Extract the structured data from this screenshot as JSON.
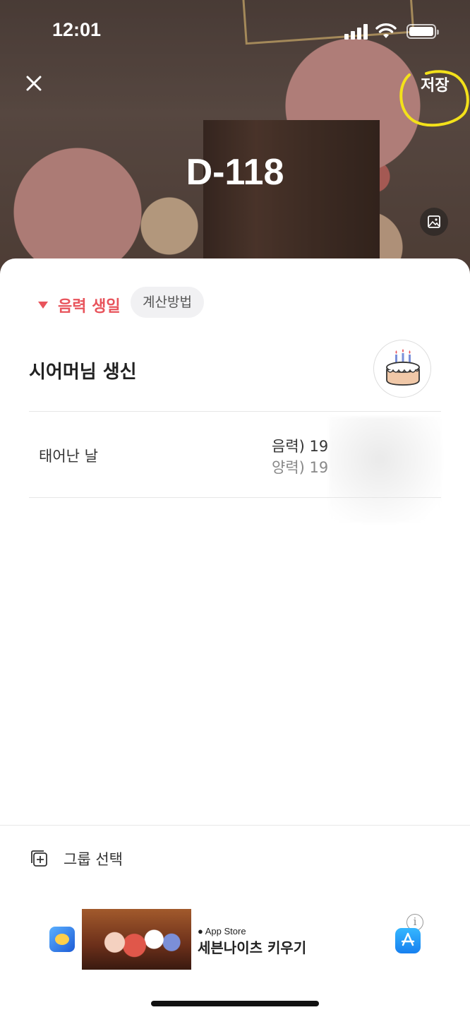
{
  "status_bar": {
    "time": "12:01"
  },
  "header": {
    "save_label": "저장",
    "d_day": "D-118",
    "highlight_color": "#f3e11a"
  },
  "event": {
    "calendar_type": "음력 생일",
    "calc_method_label": "계산방법",
    "title": "시어머님 생신",
    "accent_color": "#e8545c"
  },
  "details": {
    "birth_label": "태어난 날",
    "lunar_date": "음력) 19",
    "solar_date": "양력) 19"
  },
  "footer": {
    "group_select_label": "그룹 선택"
  },
  "ad": {
    "store_label": "App Store",
    "title": "세븐나이츠 키우기",
    "info_glyph": "i"
  },
  "icons": [
    "close-icon",
    "photo-icon",
    "cake-icon",
    "add-group-icon",
    "app-store-icon",
    "info-icon"
  ]
}
